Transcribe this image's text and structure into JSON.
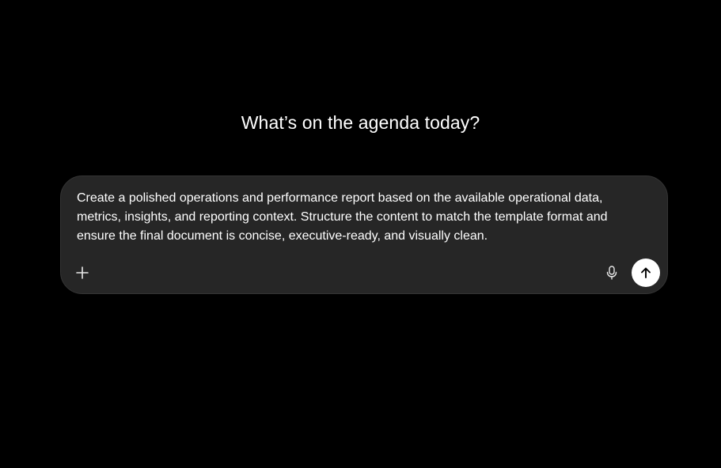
{
  "main": {
    "headline": "What’s on the agenda today?"
  },
  "composer": {
    "value": "Create a polished operations and performance report based on the available operational data, metrics, insights, and reporting context. Structure the content to match the template format and ensure the final document is concise, executive-ready, and visually clean."
  },
  "icons": {
    "add": "plus-icon",
    "voice": "microphone-icon",
    "send": "arrow-up-icon"
  },
  "colors": {
    "background": "#000000",
    "composer_background": "#262626",
    "text": "#ffffff",
    "send_button": "#ffffff"
  }
}
